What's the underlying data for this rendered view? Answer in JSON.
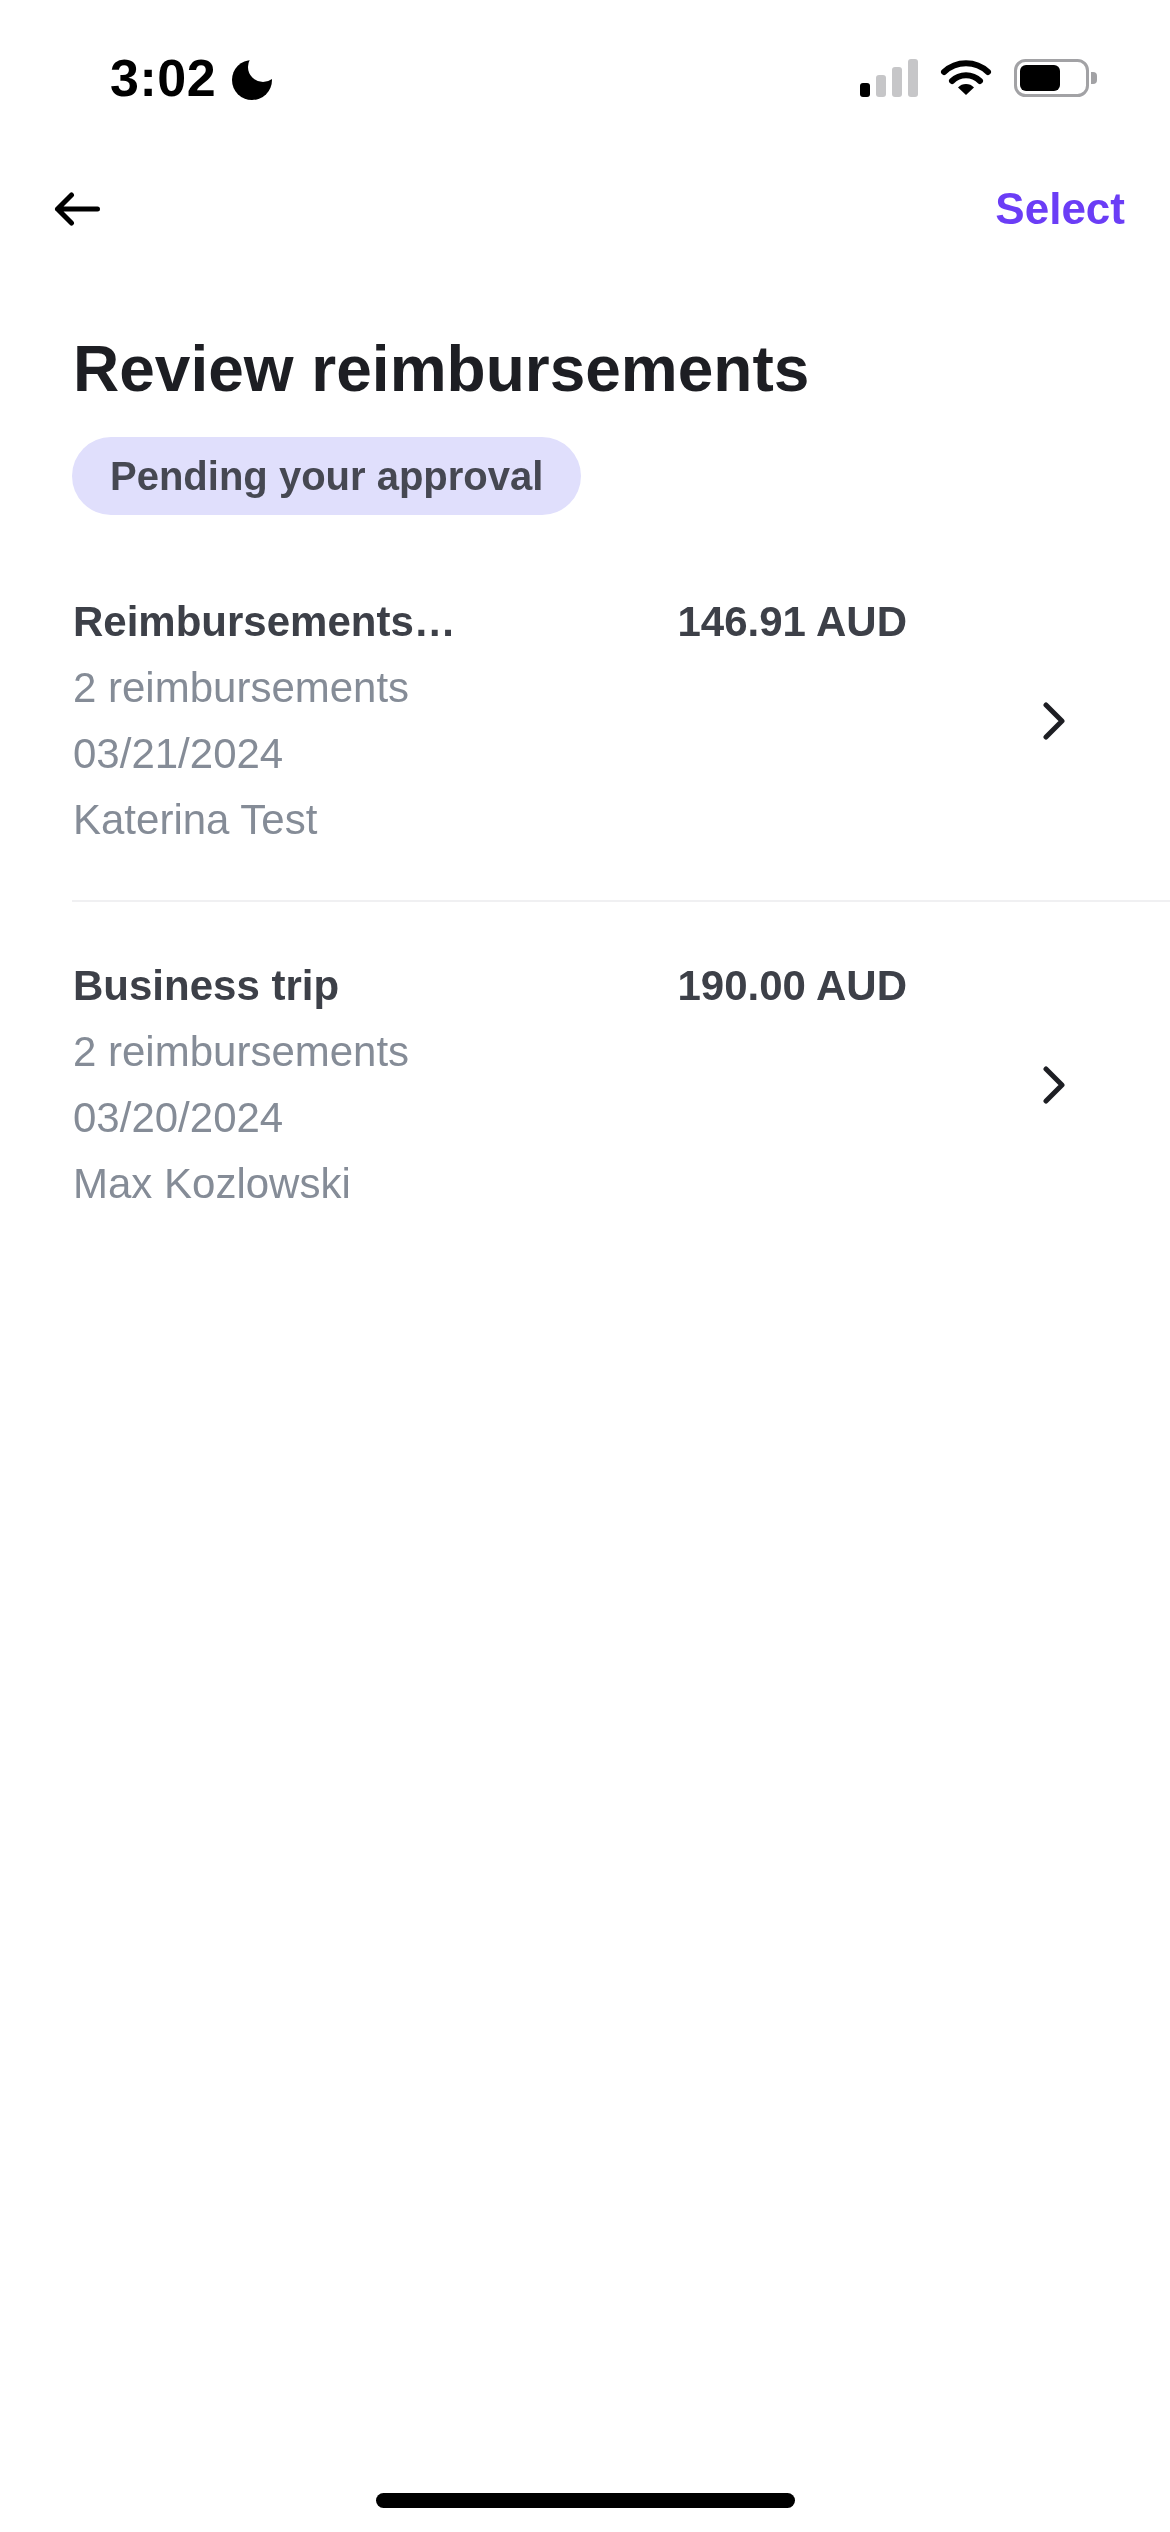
{
  "status_bar": {
    "time": "3:02"
  },
  "header": {
    "action": "Select"
  },
  "title": "Review reimbursements",
  "filter": {
    "label": "Pending your approval"
  },
  "reports": [
    {
      "title": "Reimbursements…",
      "amount": "146.91 AUD",
      "count": "2 reimbursements",
      "date": "03/21/2024",
      "submitter": "Katerina Test"
    },
    {
      "title": "Business trip",
      "amount": "190.00 AUD",
      "count": "2 reimbursements",
      "date": "03/20/2024",
      "submitter": "Max Kozlowski"
    }
  ]
}
